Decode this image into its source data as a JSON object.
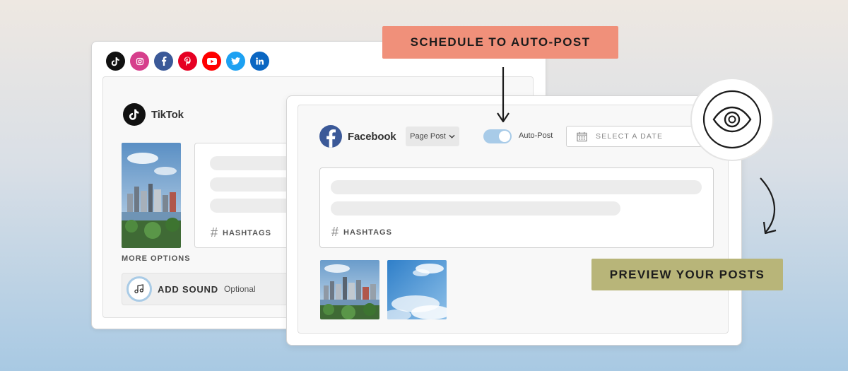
{
  "colors": {
    "schedule_callout": "#f0907a",
    "preview_callout": "#b8b579",
    "toggle_on": "#a8cbe8",
    "facebook": "#3b5998",
    "tiktok": "#111111"
  },
  "social_icons": [
    {
      "icon": "tiktok-icon",
      "color": "#111111"
    },
    {
      "icon": "instagram-icon",
      "color": "#d63f8c"
    },
    {
      "icon": "facebook-icon",
      "color": "#3b5998"
    },
    {
      "icon": "pinterest-icon",
      "color": "#e60023"
    },
    {
      "icon": "youtube-icon",
      "color": "#ff0000"
    },
    {
      "icon": "twitter-icon",
      "color": "#1da1f2"
    },
    {
      "icon": "linkedin-icon",
      "color": "#0a66c2"
    }
  ],
  "tiktok_card": {
    "brand": "TikTok",
    "hashtags_label": "HASHTAGS",
    "more_options_label": "MORE OPTIONS",
    "add_sound_label": "ADD SOUND",
    "add_sound_optional": "Optional"
  },
  "facebook_card": {
    "brand": "Facebook",
    "post_type": "Page Post",
    "auto_post_label": "Auto-Post",
    "auto_post_enabled": true,
    "date_placeholder": "SELECT A DATE",
    "hashtags_label": "HASHTAGS"
  },
  "callouts": {
    "schedule": "SCHEDULE TO AUTO-POST",
    "preview": "PREVIEW YOUR POSTS"
  },
  "icons": {
    "eye": "eye-icon",
    "calendar": "calendar-icon",
    "music_note": "music-note-icon",
    "hash": "hash-icon"
  }
}
